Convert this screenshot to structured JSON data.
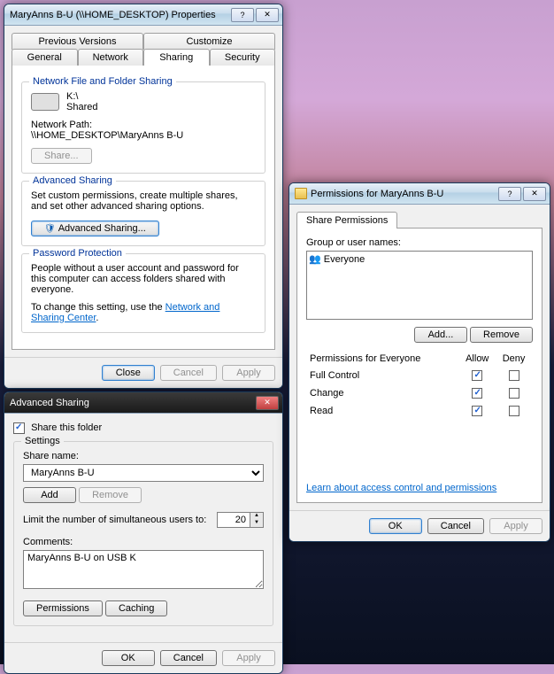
{
  "props": {
    "title": "MaryAnns B-U (\\\\HOME_DESKTOP) Properties",
    "tabs_row1": [
      "Previous Versions",
      "Customize"
    ],
    "tabs_row2": [
      "General",
      "Network",
      "Sharing",
      "Security"
    ],
    "active_tab": "Sharing",
    "nfs": {
      "legend": "Network File and Folder Sharing",
      "drive": "K:\\",
      "status": "Shared",
      "path_label": "Network Path:",
      "path": "\\\\HOME_DESKTOP\\MaryAnns B-U",
      "share_btn": "Share..."
    },
    "adv": {
      "legend": "Advanced Sharing",
      "text": "Set custom permissions, create multiple shares, and set other advanced sharing options.",
      "btn": "Advanced Sharing..."
    },
    "pwd": {
      "legend": "Password Protection",
      "text": "People without a user account and password for this computer can access folders shared with everyone.",
      "change_prefix": "To change this setting, use the ",
      "link": "Network and Sharing Center",
      "suffix": "."
    },
    "buttons": {
      "close": "Close",
      "cancel": "Cancel",
      "apply": "Apply"
    }
  },
  "advdlg": {
    "title": "Advanced Sharing",
    "share_cb": "Share this folder",
    "share_checked": true,
    "settings_legend": "Settings",
    "share_name_label": "Share name:",
    "share_name": "MaryAnns B-U",
    "add": "Add",
    "remove": "Remove",
    "limit_label": "Limit the number of simultaneous users to:",
    "limit": "20",
    "comments_label": "Comments:",
    "comments": "MaryAnns B-U on USB K",
    "permissions": "Permissions",
    "caching": "Caching",
    "ok": "OK",
    "cancel": "Cancel",
    "apply": "Apply"
  },
  "perm": {
    "title": "Permissions for MaryAnns B-U",
    "tab": "Share Permissions",
    "group_label": "Group or user names:",
    "users": [
      "Everyone"
    ],
    "add": "Add...",
    "remove": "Remove",
    "perm_for": "Permissions for Everyone",
    "allow": "Allow",
    "deny": "Deny",
    "rows": [
      {
        "name": "Full Control",
        "allow": true,
        "deny": false
      },
      {
        "name": "Change",
        "allow": true,
        "deny": false
      },
      {
        "name": "Read",
        "allow": true,
        "deny": false
      }
    ],
    "learn": "Learn about access control and permissions",
    "ok": "OK",
    "cancel": "Cancel",
    "apply": "Apply"
  }
}
